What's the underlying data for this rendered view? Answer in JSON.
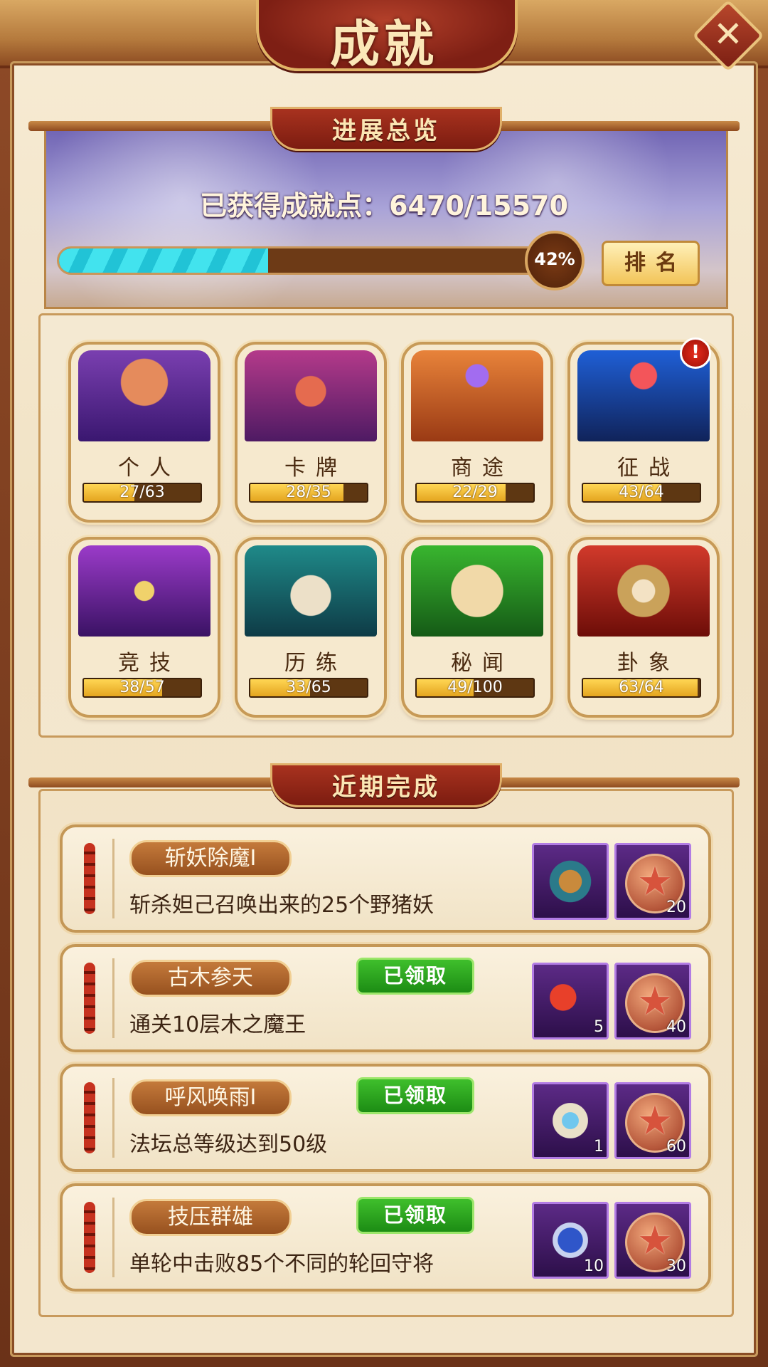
{
  "title": "成就",
  "close_icon": "close-icon",
  "overview": {
    "section_label": "进展总览",
    "points_text": "已获得成就点：6470/15570",
    "progress_fraction": 0.42,
    "progress_label": "42%",
    "rank_button": "排名"
  },
  "categories": [
    {
      "name": "个人",
      "progress": "27/63",
      "fraction": 0.43,
      "icon": "book-star-icon"
    },
    {
      "name": "卡牌",
      "progress": "28/35",
      "fraction": 0.8,
      "icon": "cards-icon"
    },
    {
      "name": "商途",
      "progress": "22/29",
      "fraction": 0.76,
      "icon": "map-pin-icon"
    },
    {
      "name": "征战",
      "progress": "43/64",
      "fraction": 0.67,
      "icon": "crossed-spears-icon",
      "alert": "!"
    },
    {
      "name": "竞技",
      "progress": "38/57",
      "fraction": 0.67,
      "icon": "crossed-swords-icon"
    },
    {
      "name": "历练",
      "progress": "33/65",
      "fraction": 0.51,
      "icon": "sword-in-scroll-icon"
    },
    {
      "name": "秘闻",
      "progress": "49/100",
      "fraction": 0.49,
      "icon": "treasure-map-icon"
    },
    {
      "name": "卦象",
      "progress": "63/64",
      "fraction": 0.98,
      "icon": "yin-yang-icon"
    }
  ],
  "recent": {
    "section_label": "近期完成",
    "items": [
      {
        "title": "斩妖除魔I",
        "desc": "斩杀妲己召唤出来的25个野猪妖",
        "claimed": "",
        "rewards": [
          {
            "icon": "scroll-card-icon",
            "count": ""
          },
          {
            "icon": "star-coin-icon",
            "count": "20"
          }
        ]
      },
      {
        "title": "古木参天",
        "desc": "通关10层木之魔王",
        "claimed": "已领取",
        "rewards": [
          {
            "icon": "red-dice-icon",
            "count": "5"
          },
          {
            "icon": "star-coin-icon",
            "count": "40"
          }
        ]
      },
      {
        "title": "呼风唤雨I",
        "desc": "法坛总等级达到50级",
        "claimed": "已领取",
        "rewards": [
          {
            "icon": "magic-scroll-icon",
            "count": "1"
          },
          {
            "icon": "star-coin-icon",
            "count": "60"
          }
        ]
      },
      {
        "title": "技压群雄",
        "desc": "单轮中击败85个不同的轮回守将",
        "claimed": "已领取",
        "rewards": [
          {
            "icon": "honor-coin-icon",
            "count": "10"
          },
          {
            "icon": "star-coin-icon",
            "count": "30"
          }
        ]
      }
    ]
  },
  "colors": {
    "accent_red": "#9c2b1a",
    "progress_cyan": "#36d6e6",
    "claimed_green": "#2aa81e",
    "bar_gold": "#f2c234"
  }
}
